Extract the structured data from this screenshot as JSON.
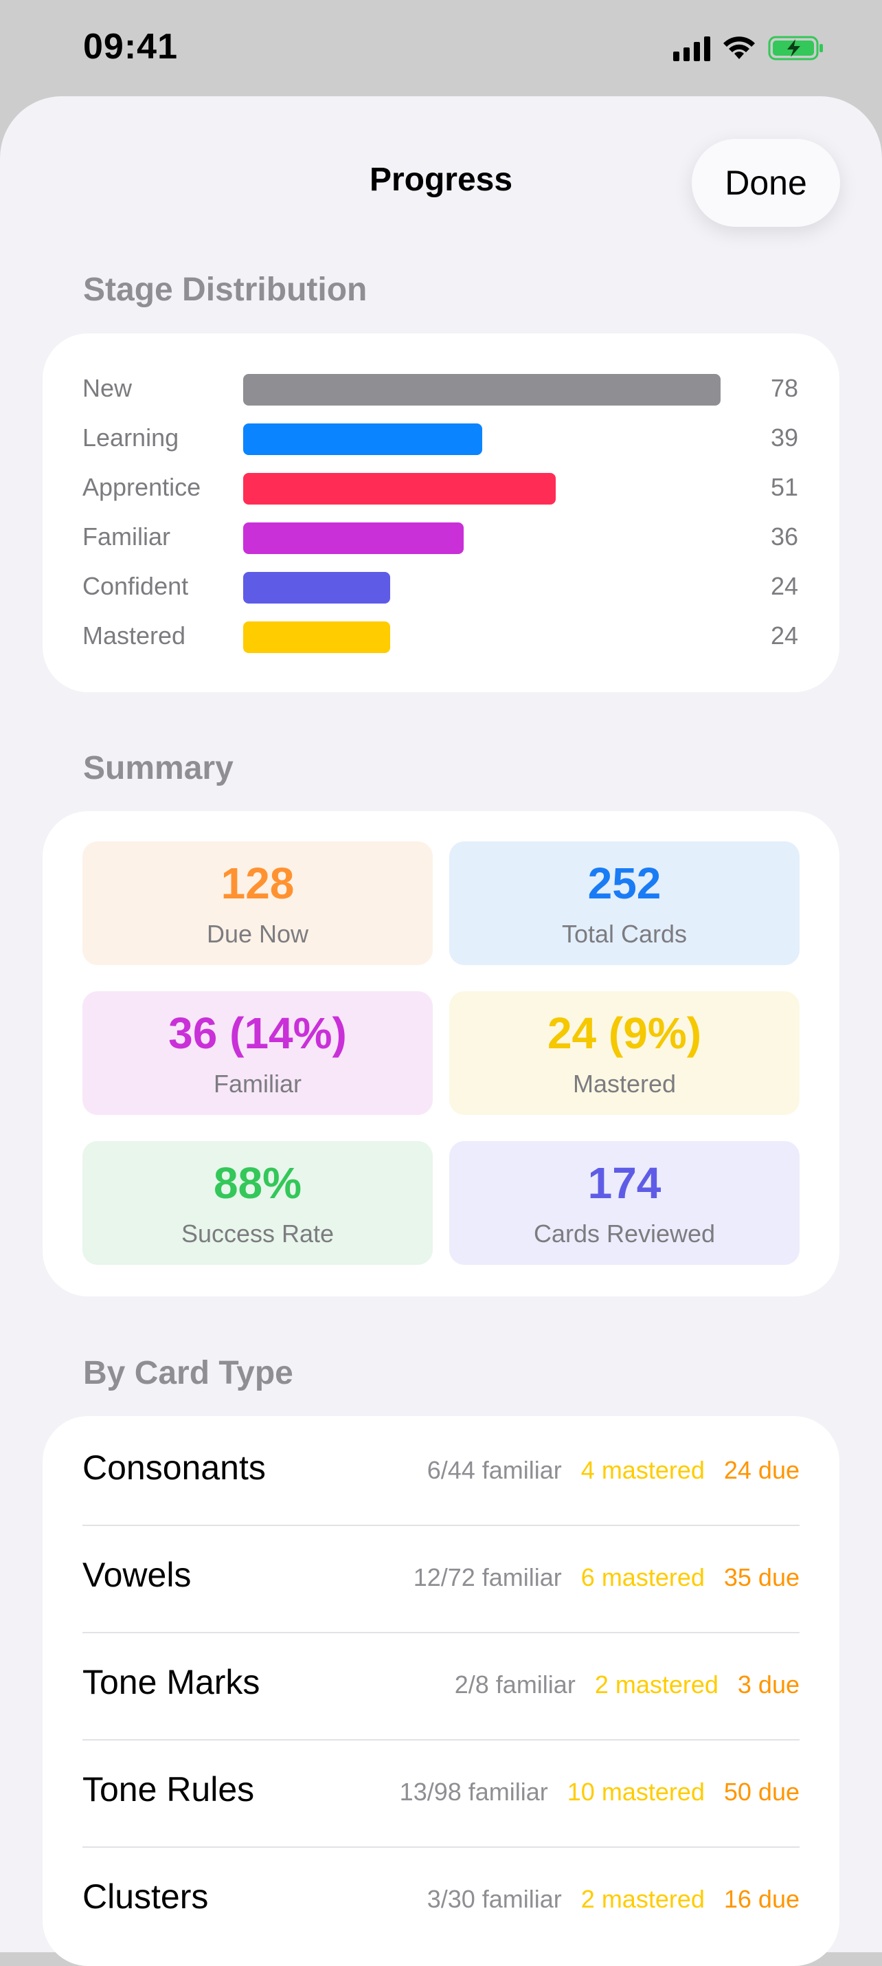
{
  "status_bar": {
    "time": "09:41"
  },
  "nav": {
    "title": "Progress",
    "done_label": "Done"
  },
  "sections": {
    "stage_distribution": "Stage Distribution",
    "summary": "Summary",
    "by_card_type": "By Card Type"
  },
  "stages": [
    {
      "label": "New",
      "count": "78",
      "fraction": 1.0,
      "color": "#8e8e93"
    },
    {
      "label": "Learning",
      "count": "39",
      "fraction": 0.5,
      "color": "#0a84ff"
    },
    {
      "label": "Apprentice",
      "count": "51",
      "fraction": 0.654,
      "color": "#ff2d55"
    },
    {
      "label": "Familiar",
      "count": "36",
      "fraction": 0.462,
      "color": "#c930d8"
    },
    {
      "label": "Confident",
      "count": "24",
      "fraction": 0.308,
      "color": "#5e5ce6"
    },
    {
      "label": "Mastered",
      "count": "24",
      "fraction": 0.308,
      "color": "#ffcc00"
    }
  ],
  "summary": [
    {
      "value": "128",
      "label": "Due Now",
      "color": "#ff9230",
      "bg": "#fdf2e8"
    },
    {
      "value": "252",
      "label": "Total Cards",
      "color": "#1a7cf5",
      "bg": "#e4effc"
    },
    {
      "value": "36 (14%)",
      "label": "Familiar",
      "color": "#c930d8",
      "bg": "#f8e7f9"
    },
    {
      "value": "24 (9%)",
      "label": "Mastered",
      "color": "#f5c800",
      "bg": "#fdf8e4"
    },
    {
      "value": "88%",
      "label": "Success Rate",
      "color": "#34c759",
      "bg": "#e8f6ec"
    },
    {
      "value": "174",
      "label": "Cards Reviewed",
      "color": "#5e5ce6",
      "bg": "#ececfc"
    }
  ],
  "card_types": [
    {
      "name": "Consonants",
      "familiar": "6/44 familiar",
      "mastered": "4 mastered",
      "due": "24 due"
    },
    {
      "name": "Vowels",
      "familiar": "12/72 familiar",
      "mastered": "6 mastered",
      "due": "35 due"
    },
    {
      "name": "Tone Marks",
      "familiar": "2/8 familiar",
      "mastered": "2 mastered",
      "due": "3 due"
    },
    {
      "name": "Tone Rules",
      "familiar": "13/98 familiar",
      "mastered": "10 mastered",
      "due": "50 due"
    },
    {
      "name": "Clusters",
      "familiar": "3/30 familiar",
      "mastered": "2 mastered",
      "due": "16 due"
    }
  ]
}
